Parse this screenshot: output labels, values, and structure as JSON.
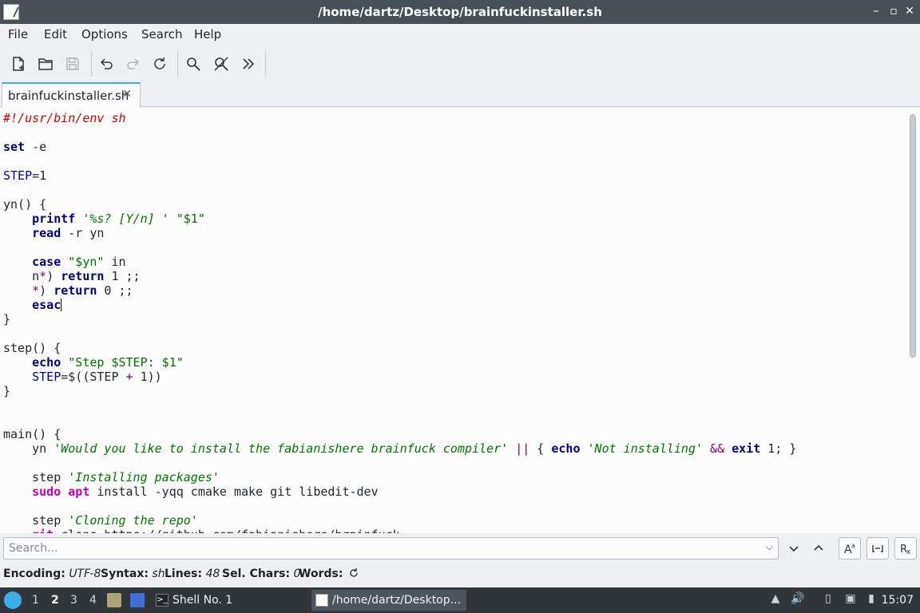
{
  "window": {
    "title": "/home/dartz/Desktop/brainfuckinstaller.sh"
  },
  "menu": [
    "File",
    "Edit",
    "Options",
    "Search",
    "Help"
  ],
  "toolbar": {
    "icons": [
      "new-file-icon",
      "open-folder-icon",
      "save-icon",
      "undo-icon",
      "redo-icon",
      "reload-icon",
      "search-icon",
      "replace-icon",
      "more-icon"
    ]
  },
  "tab": {
    "label": "brainfuckinstaller.sh",
    "close": "✕"
  },
  "code_lines": [
    [
      [
        "c-comment",
        "#!/usr/bin/env sh"
      ]
    ],
    [],
    [
      [
        "c-kw",
        "set"
      ],
      [
        "",
        " -e"
      ]
    ],
    [],
    [
      [
        "c-var",
        "STEP"
      ],
      [
        "",
        "=1"
      ]
    ],
    [],
    [
      [
        "",
        "yn() {"
      ]
    ],
    [
      [
        "",
        "    "
      ],
      [
        "c-kw",
        "printf"
      ],
      [
        "",
        " "
      ],
      [
        "c-istr",
        "'%s? [Y/n] '"
      ],
      [
        "",
        " "
      ],
      [
        "c-str",
        "\"$1\""
      ]
    ],
    [
      [
        "",
        "    "
      ],
      [
        "c-kw",
        "read"
      ],
      [
        "",
        " -r yn"
      ]
    ],
    [],
    [
      [
        "",
        "    "
      ],
      [
        "c-kw",
        "case"
      ],
      [
        "",
        " "
      ],
      [
        "c-str",
        "\"$yn\""
      ],
      [
        "",
        " in"
      ]
    ],
    [
      [
        "",
        "    n"
      ],
      [
        "c-op",
        "*"
      ],
      [
        "",
        ") "
      ],
      [
        "c-kw",
        "return"
      ],
      [
        "",
        " 1 ;;"
      ]
    ],
    [
      [
        "",
        "    "
      ],
      [
        "c-op",
        "*"
      ],
      [
        "",
        ") "
      ],
      [
        "c-kw",
        "return"
      ],
      [
        "",
        " 0 ;;"
      ]
    ],
    [
      [
        "",
        "    "
      ],
      [
        "c-kw",
        "esac"
      ],
      [
        "cursor",
        ""
      ]
    ],
    [
      [
        "",
        "}"
      ]
    ],
    [],
    [
      [
        "",
        "step() {"
      ]
    ],
    [
      [
        "",
        "    "
      ],
      [
        "c-kw",
        "echo"
      ],
      [
        "",
        " "
      ],
      [
        "c-str",
        "\"Step $STEP: $1\""
      ]
    ],
    [
      [
        "",
        "    "
      ],
      [
        "c-var",
        "STEP"
      ],
      [
        "",
        "=$((STEP "
      ],
      [
        "c-op",
        "+"
      ],
      [
        "",
        " 1))"
      ]
    ],
    [
      [
        "",
        "}"
      ]
    ],
    [],
    [],
    [
      [
        "",
        "main() {"
      ]
    ],
    [
      [
        "",
        "    yn "
      ],
      [
        "c-istr",
        "'Would you like to install the fabianishere brainfuck compiler'"
      ],
      [
        "",
        " "
      ],
      [
        "c-op",
        "||"
      ],
      [
        "",
        " { "
      ],
      [
        "c-kw",
        "echo"
      ],
      [
        "",
        " "
      ],
      [
        "c-istr",
        "'Not installing'"
      ],
      [
        "",
        " "
      ],
      [
        "c-op",
        "&&"
      ],
      [
        "",
        " "
      ],
      [
        "c-kw",
        "exit"
      ],
      [
        "",
        " 1; }"
      ]
    ],
    [],
    [
      [
        "",
        "    step "
      ],
      [
        "c-istr",
        "'Installing packages'"
      ]
    ],
    [
      [
        "",
        "    "
      ],
      [
        "c-sudo",
        "sudo"
      ],
      [
        "",
        " "
      ],
      [
        "c-sudo",
        "apt"
      ],
      [
        "",
        " install -yqq cmake make git libedit-dev"
      ]
    ],
    [],
    [
      [
        "",
        "    step "
      ],
      [
        "c-istr",
        "'Cloning the repo'"
      ]
    ],
    [
      [
        "",
        "    "
      ],
      [
        "c-sudo",
        "git"
      ],
      [
        "",
        " clone https://github.com/fabianishere/brainfuck"
      ]
    ]
  ],
  "search": {
    "placeholder": "Search..."
  },
  "status": {
    "encoding_label": "Encoding:",
    "encoding": "UTF-8",
    "syntax_label": "Syntax:",
    "syntax": "sh",
    "lines_label": "Lines:",
    "lines": "48",
    "selchars_label": "Sel. Chars:",
    "selchars": "0",
    "words_label": "Words:"
  },
  "taskbar": {
    "workspaces": [
      "1",
      "2",
      "3",
      "4"
    ],
    "active_workspace": "2",
    "tasks": [
      {
        "label": "Shell No. 1"
      },
      {
        "label": "/home/dartz/Desktop..."
      }
    ],
    "clock": "15:07"
  },
  "colors": {
    "accent": "#3daee9",
    "titlebar": "#475057",
    "taskbar": "#31363b"
  }
}
